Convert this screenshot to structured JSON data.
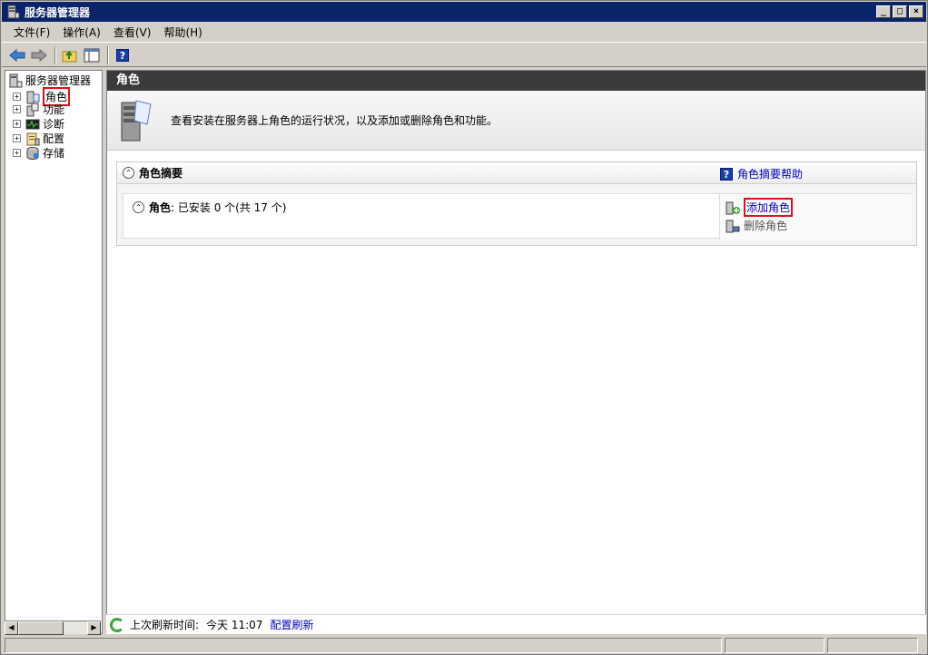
{
  "window": {
    "title": "服务器管理器",
    "controls": [
      "_",
      "□",
      "×"
    ]
  },
  "menu": [
    "文件(F)",
    "操作(A)",
    "查看(V)",
    "帮助(H)"
  ],
  "toolbar": {
    "icons": [
      "back-arrow-icon",
      "forward-arrow-icon",
      "up-folder-icon",
      "show-hide-console-tree-icon",
      "help-icon"
    ],
    "help_glyph": "?"
  },
  "tree": {
    "root": "服务器管理器",
    "items": [
      {
        "label": "角色",
        "highlighted": true
      },
      {
        "label": "功能"
      },
      {
        "label": "诊断"
      },
      {
        "label": "配置"
      },
      {
        "label": "存储"
      }
    ],
    "expander": "+"
  },
  "main": {
    "header": "角色",
    "description": "查看安装在服务器上角色的运行状况，以及添加或删除角色和功能。",
    "section": {
      "title": "角色摘要",
      "help_link": "角色摘要帮助",
      "help_glyph": "?",
      "roles_label": "角色",
      "roles_value": ": 已安装 0 个(共 17 个)",
      "tasks": {
        "add": "添加角色",
        "remove": "删除角色"
      }
    },
    "status": {
      "label": "上次刷新时间:",
      "value": "今天 11:07",
      "link": "配置刷新"
    }
  },
  "colors": {
    "titlebar": "#0a246a",
    "header": "#3b3b3b",
    "link": "#0000c0",
    "highlight": "#e0101c"
  }
}
